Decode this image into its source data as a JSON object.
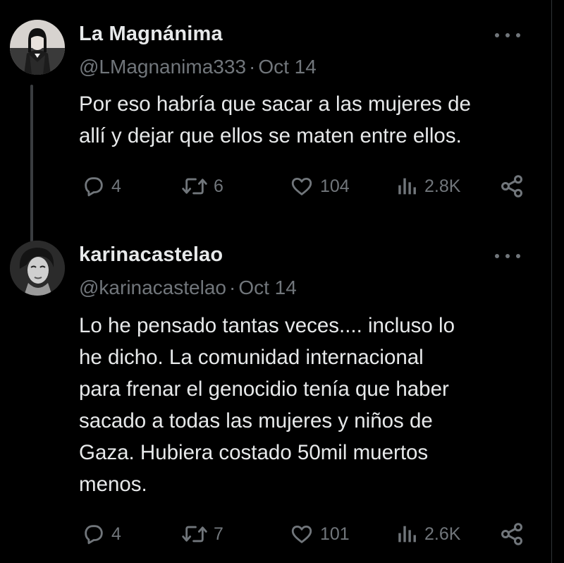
{
  "tweets": [
    {
      "display_name": "La Magnánima",
      "handle": "@LMagnanima333",
      "separator": "·",
      "date": "Oct 14",
      "text_lines": [
        "Por eso habría que sacar a las mujeres de",
        "allí y dejar que ellos se maten entre ellos."
      ],
      "replies": "4",
      "retweets": "6",
      "likes": "104",
      "views": "2.8K"
    },
    {
      "display_name": "karinacastelao",
      "handle": "@karinacastelao",
      "separator": "·",
      "date": "Oct 14",
      "text_lines": [
        "Lo he pensado tantas veces.... incluso lo",
        "he dicho. La comunidad internacional",
        "para frenar el genocidio tenía que haber",
        "sacado a todas las mujeres y niños de",
        "Gaza. Hubiera costado 50mil muertos",
        "menos."
      ],
      "replies": "4",
      "retweets": "7",
      "likes": "101",
      "views": "2.6K"
    }
  ],
  "icons": {
    "reply": "reply-icon",
    "retweet": "retweet-icon",
    "like": "heart-icon",
    "views": "views-icon",
    "share": "share-icon",
    "more": "more-icon"
  },
  "colors": {
    "background": "#000000",
    "text": "#e7e9ea",
    "muted": "#71767b",
    "thread_line": "#3a3d40"
  }
}
